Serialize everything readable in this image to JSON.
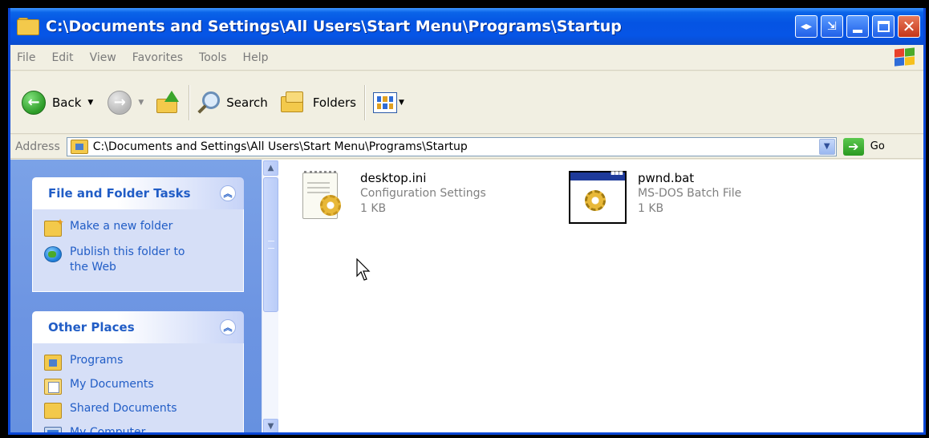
{
  "window": {
    "title": "C:\\Documents and Settings\\All Users\\Start Menu\\Programs\\Startup"
  },
  "menu": {
    "items": [
      "File",
      "Edit",
      "View",
      "Favorites",
      "Tools",
      "Help"
    ]
  },
  "toolbar": {
    "back_label": "Back",
    "search_label": "Search",
    "folders_label": "Folders"
  },
  "address": {
    "label": "Address",
    "value": "C:\\Documents and Settings\\All Users\\Start Menu\\Programs\\Startup",
    "go_label": "Go"
  },
  "tasks_panel": {
    "title": "File and Folder Tasks",
    "items": [
      {
        "label": "Make a new folder",
        "icon": "new-folder-icon"
      },
      {
        "label": "Publish this folder to the Web",
        "icon": "globe-icon"
      }
    ]
  },
  "places_panel": {
    "title": "Other Places",
    "items": [
      {
        "label": "Programs",
        "icon": "programs-folder-icon"
      },
      {
        "label": "My Documents",
        "icon": "my-documents-icon"
      },
      {
        "label": "Shared Documents",
        "icon": "shared-documents-icon"
      },
      {
        "label": "My Computer",
        "icon": "my-computer-icon"
      }
    ]
  },
  "files": [
    {
      "name": "desktop.ini",
      "type": "Configuration Settings",
      "size": "1 KB",
      "icon": "config-file-icon"
    },
    {
      "name": "pwnd.bat",
      "type": "MS-DOS Batch File",
      "size": "1 KB",
      "icon": "batch-file-icon"
    }
  ],
  "colors": {
    "titlebar": "#0554E3",
    "taskpane": "#6C94E2",
    "link": "#215DC6"
  }
}
